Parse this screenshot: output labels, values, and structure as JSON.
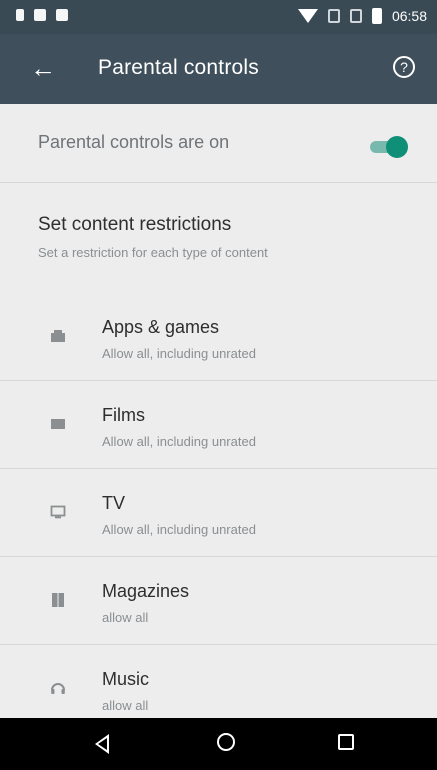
{
  "status_bar": {
    "time": "06:58"
  },
  "app_bar": {
    "title": "Parental controls"
  },
  "toggle": {
    "label": "Parental controls are on",
    "state": "on",
    "accent": "#0f8f78"
  },
  "section": {
    "title": "Set content restrictions",
    "subtitle": "Set a restriction for each type of content"
  },
  "items": [
    {
      "name": "Apps & games",
      "desc": "Allow all, including unrated",
      "icon": "apps-icon"
    },
    {
      "name": "Films",
      "desc": "Allow all, including unrated",
      "icon": "film-icon"
    },
    {
      "name": "TV",
      "desc": "Allow all, including unrated",
      "icon": "tv-icon"
    },
    {
      "name": "Magazines",
      "desc": "allow all",
      "icon": "magazine-icon"
    },
    {
      "name": "Music",
      "desc": "allow all",
      "icon": "headphones-icon"
    }
  ]
}
